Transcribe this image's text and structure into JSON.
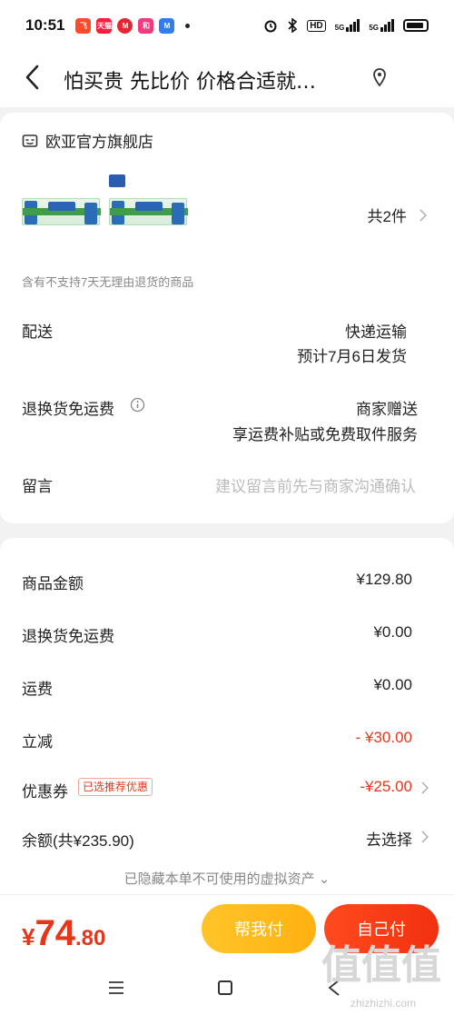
{
  "status_bar": {
    "time": "10:51",
    "apps": [
      {
        "name": "app-icon-1",
        "label": "飞",
        "color": "#ff4b2b"
      },
      {
        "name": "app-icon-2",
        "label": "天猫",
        "color": "#ff1d3b"
      },
      {
        "name": "app-icon-3",
        "label": "M",
        "color": "#e8262f"
      },
      {
        "name": "app-icon-4",
        "label": "和",
        "color": "#f23a7d"
      },
      {
        "name": "app-icon-5",
        "label": "M",
        "color": "#2f7ff2"
      }
    ],
    "network": "HD",
    "signal_1": "5G",
    "signal_2": "5G"
  },
  "header": {
    "title": "怕买贵 先比价 价格合适就…"
  },
  "order": {
    "store_name": "欧亚官方旗舰店",
    "item_count": "共2件",
    "return_notice": "含有不支持7天无理由退货的商品",
    "delivery": {
      "label": "配送",
      "method": "快递运输",
      "eta": "预计7月6日发货"
    },
    "return_shipping": {
      "label": "退换货免运费",
      "value": "商家赠送",
      "detail": "享运费补贴或免费取件服务"
    },
    "message": {
      "label": "留言",
      "placeholder": "建议留言前先与商家沟通确认"
    }
  },
  "amounts": {
    "goods": {
      "label": "商品金额",
      "value": "¥129.80"
    },
    "return_free": {
      "label": "退换货免运费",
      "value": "¥0.00"
    },
    "shipping": {
      "label": "运费",
      "value": "¥0.00"
    },
    "discount": {
      "label": "立减",
      "value": "- ¥30.00"
    },
    "coupon": {
      "label": "优惠券",
      "tag": "已选推荐优惠",
      "value": "-¥25.00"
    },
    "balance": {
      "label": "余额(共¥235.90)",
      "value": "去选择"
    },
    "hidden_note": "已隐藏本单不可使用的虚拟资产 ⌄"
  },
  "footer": {
    "total_symbol": "¥",
    "total_int": "74",
    "total_dec": ".80",
    "help_pay": "帮我付",
    "self_pay": "自己付"
  },
  "watermark": {
    "glyphs": "值值值",
    "text": "zhizhizhi.com"
  },
  "colors": {
    "accent_red": "#e5361c",
    "help_button": "#ffb110",
    "pay_button": "#f2300f"
  }
}
